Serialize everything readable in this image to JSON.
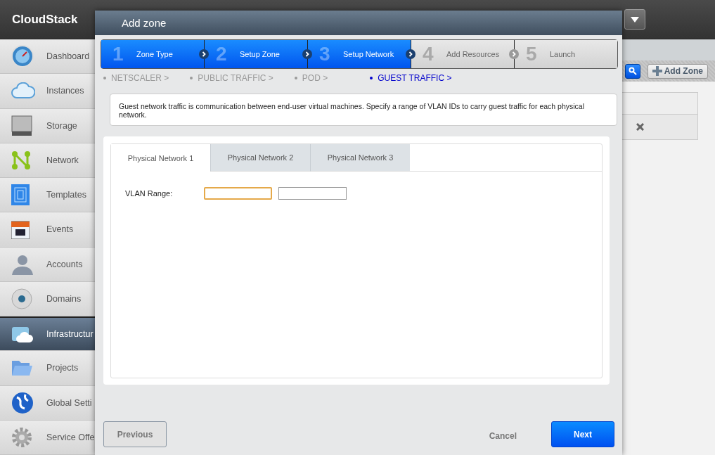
{
  "app": {
    "title": "CloudStack"
  },
  "sidebar": {
    "items": [
      {
        "label": "Dashboard",
        "selected": false
      },
      {
        "label": "Instances",
        "selected": false
      },
      {
        "label": "Storage",
        "selected": false
      },
      {
        "label": "Network",
        "selected": false
      },
      {
        "label": "Templates",
        "selected": false
      },
      {
        "label": "Events",
        "selected": false
      },
      {
        "label": "Accounts",
        "selected": false
      },
      {
        "label": "Domains",
        "selected": false
      },
      {
        "label": "Infrastructur",
        "selected": true
      },
      {
        "label": "Projects",
        "selected": false
      },
      {
        "label": "Global Setti",
        "selected": false
      },
      {
        "label": "Service Offe",
        "selected": false
      }
    ]
  },
  "toolbar": {
    "add_button": "Add Zone"
  },
  "dialog": {
    "title": "Add zone",
    "steps": [
      {
        "number": "1",
        "label": "Zone Type",
        "active": true
      },
      {
        "number": "2",
        "label": "Setup Zone",
        "active": true
      },
      {
        "number": "3",
        "label": "Setup Network",
        "active": true
      },
      {
        "number": "4",
        "label": "Add Resources",
        "active": false
      },
      {
        "number": "5",
        "label": "Launch",
        "active": false
      }
    ],
    "substeps": [
      {
        "label": "NETSCALER >",
        "selected": false
      },
      {
        "label": "PUBLIC TRAFFIC >",
        "selected": false
      },
      {
        "label": "POD >",
        "selected": false
      },
      {
        "label": "GUEST TRAFFIC >",
        "selected": true
      }
    ],
    "description": "Guest network traffic is communication between end-user virtual machines. Specify a range of VLAN IDs to carry guest traffic for each physical network.",
    "tabs": [
      {
        "label": "Physical Network 1",
        "selected": true
      },
      {
        "label": "Physical Network 2",
        "selected": false
      },
      {
        "label": "Physical Network 3",
        "selected": false
      }
    ],
    "vlan_range": {
      "label": "VLAN Range:",
      "inputs": [
        {
          "focused": true
        },
        {
          "focused": false
        }
      ]
    },
    "previous_button": {
      "label": "Previous",
      "disabled": true
    },
    "cancel_button": "Cancel",
    "next_button": "Next"
  }
}
